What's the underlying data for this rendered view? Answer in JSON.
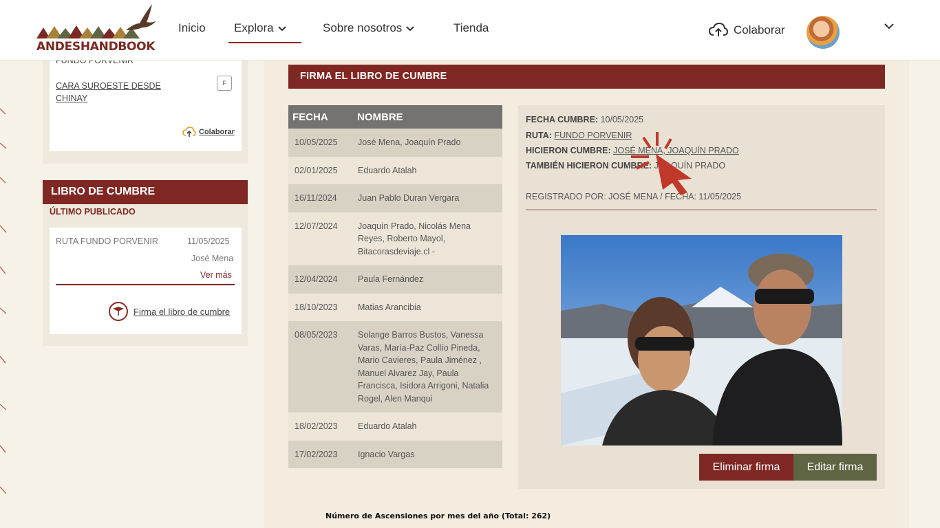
{
  "header": {
    "logo_text": "ANDESHANDBOOK",
    "nav": [
      {
        "label": "Inicio"
      },
      {
        "label": "Explora"
      },
      {
        "label": "Sobre nosotros"
      },
      {
        "label": "Tienda"
      }
    ],
    "colaborar_label": "Colaborar"
  },
  "sidebar": {
    "routes_card": {
      "cut_link": "FUNDO PORVENIR",
      "route_link": "CARA SUROESTE DESDE CHINAY",
      "route_badge": "F",
      "colaborar_label": "Colaborar"
    },
    "libro": {
      "title": "LIBRO DE CUMBRE",
      "subtitle": "ÚLTIMO PUBLICADO",
      "route": "RUTA FUNDO PORVENIR",
      "date": "11/05/2025",
      "name": "José Mena",
      "more": "Ver más",
      "sign_link": "Firma el libro de cumbre"
    }
  },
  "main": {
    "section_title": "FIRMA EL LIBRO DE CUMBRE",
    "table": {
      "headers": [
        "FECHA",
        "NOMBRE"
      ],
      "rows": [
        {
          "date": "10/05/2025",
          "name": "José Mena, Joaquín Prado"
        },
        {
          "date": "02/01/2025",
          "name": "Eduardo Atalah"
        },
        {
          "date": "16/11/2024",
          "name": "Juan Pablo Duran Vergara"
        },
        {
          "date": "12/07/2024",
          "name": "Joaquín Prado, Nicolás Mena Reyes, Roberto Mayol, Bitacorasdeviaje.cl -"
        },
        {
          "date": "12/04/2024",
          "name": "Paula Fernández"
        },
        {
          "date": "18/10/2023",
          "name": "Matias Arancibia"
        },
        {
          "date": "08/05/2023",
          "name": "Solange Barros Bustos, Vanessa Varas, María-Paz Collío Pineda, Mario Cavieres, Paula Jiménez , Manuel Alvarez Jay, Paula Francisca, Isidora Arrigoni, Natalia Rogel, Alen Manqui"
        },
        {
          "date": "18/02/2023",
          "name": "Eduardo Atalah"
        },
        {
          "date": "17/02/2023",
          "name": "Ignacio Vargas"
        }
      ]
    },
    "detail": {
      "fecha_label": "FECHA CUMBRE:",
      "fecha_value": "10/05/2025",
      "ruta_label": "RUTA:",
      "ruta_value": "FUNDO PORVENIR",
      "hicieron_label": "HICIERON CUMBRE:",
      "hicieron_value": "JOSÉ MENA, JOAQUÍN PRADO",
      "tambien_label": "TAMBIÉN HICIERON CUMBRE:",
      "tambien_value": "JOAQUÍN PRADO",
      "registrado": "REGISTRADO POR: JOSÉ MENA / FECHA: 11/05/2025",
      "delete_label": "Eliminar firma",
      "edit_label": "Editar firma"
    },
    "chart_title": "Número de Ascensiones por mes del año (Total: 262)"
  },
  "colors": {
    "brand_red": "#7f2823",
    "olive": "#5f6443",
    "table_header": "#747370"
  }
}
